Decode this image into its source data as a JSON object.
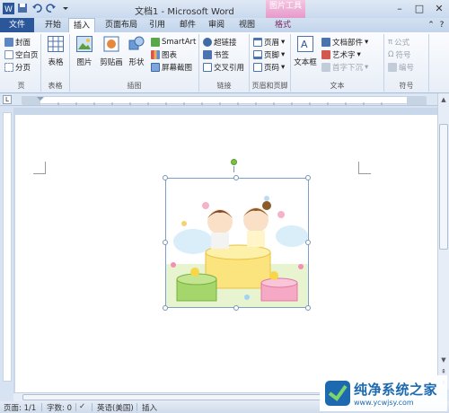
{
  "title_bar": {
    "title": "文档1 - Microsoft Word",
    "contextual_tab_group": "图片工具"
  },
  "tabs": [
    {
      "label": "文件"
    },
    {
      "label": "开始"
    },
    {
      "label": "插入"
    },
    {
      "label": "页面布局"
    },
    {
      "label": "引用"
    },
    {
      "label": "邮件"
    },
    {
      "label": "审阅"
    },
    {
      "label": "视图"
    },
    {
      "label": "格式"
    }
  ],
  "ribbon": {
    "pages": {
      "label": "页",
      "items": [
        "封面",
        "空白页",
        "分页"
      ]
    },
    "tables": {
      "label": "表格",
      "button": "表格"
    },
    "illustrations": {
      "label": "插图",
      "picture": "图片",
      "clipart": "剪贴画",
      "shapes": "形状",
      "smartart": "SmartArt",
      "chart": "图表",
      "screenshot": "屏幕截图"
    },
    "links": {
      "label": "链接",
      "items": [
        "超链接",
        "书签",
        "交叉引用"
      ]
    },
    "header_footer": {
      "label": "页眉和页脚",
      "items": [
        "页眉",
        "页脚",
        "页码"
      ]
    },
    "text": {
      "label": "文本",
      "textbox": "文本框",
      "quick_parts": "文档部件",
      "wordart": "艺术字",
      "dropcap": "首字下沉"
    },
    "symbols": {
      "label": "符号",
      "items": [
        "公式",
        "符号",
        "编号"
      ]
    }
  },
  "ruler": {
    "corner": "L"
  },
  "status_bar": {
    "page": "页面: 1/1",
    "words": "字数: 0",
    "language": "英语(美国)",
    "mode": "插入"
  },
  "watermark": {
    "name": "纯净系统之家",
    "url": "www.ycwjsy.com"
  },
  "colors": {
    "file_tab": "#2b579a",
    "picture_tools": "#e59acb",
    "ribbon_bg": "#fbfcfe"
  }
}
